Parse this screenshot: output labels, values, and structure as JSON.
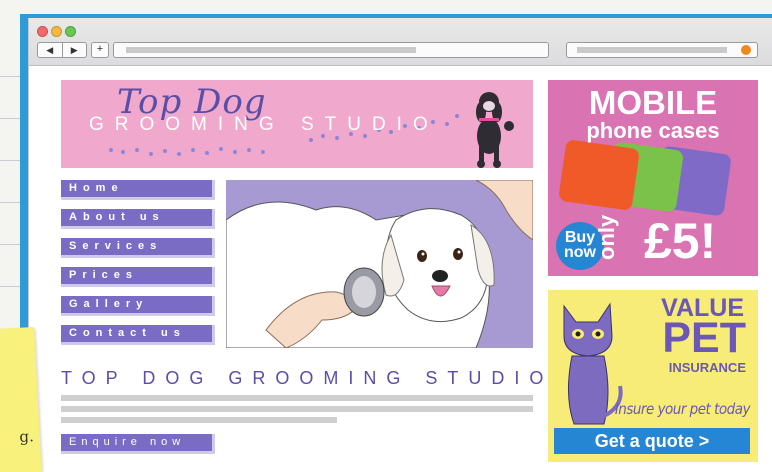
{
  "browser": {
    "nav_back": "◀",
    "nav_forward": "▶",
    "new_tab": "+",
    "traffic_colors": [
      "#f3686a",
      "#f6b940",
      "#67c94d"
    ],
    "search_go_color": "#f0881e"
  },
  "logo": {
    "script": "Top Dog",
    "subtitle": "GROOMING STUDIO"
  },
  "nav": {
    "items": [
      "Home",
      "About us",
      "Services",
      "Prices",
      "Gallery",
      "Contact us"
    ]
  },
  "main": {
    "heading": "TOP DOG GROOMING STUDIO",
    "enquire_label": "Enquire now"
  },
  "ads": {
    "mobile": {
      "line1": "MOBILE",
      "line2": "phone cases",
      "badge": "Buy now",
      "only": "only",
      "price": "£5!"
    },
    "pet": {
      "value": "VALUE",
      "pet": "PET",
      "insurance": "INSURANCE",
      "tagline": "Insure your pet today",
      "cta": "Get a quote >"
    }
  },
  "sticky_note": {
    "text": "g."
  },
  "colors": {
    "frame": "#2f9bd6",
    "banner": "#f0a9cc",
    "nav_button": "#7a6bc4",
    "ad_mobile": "#d973b2",
    "ad_pet": "#f7ec78",
    "cta_blue": "#2587d4"
  }
}
